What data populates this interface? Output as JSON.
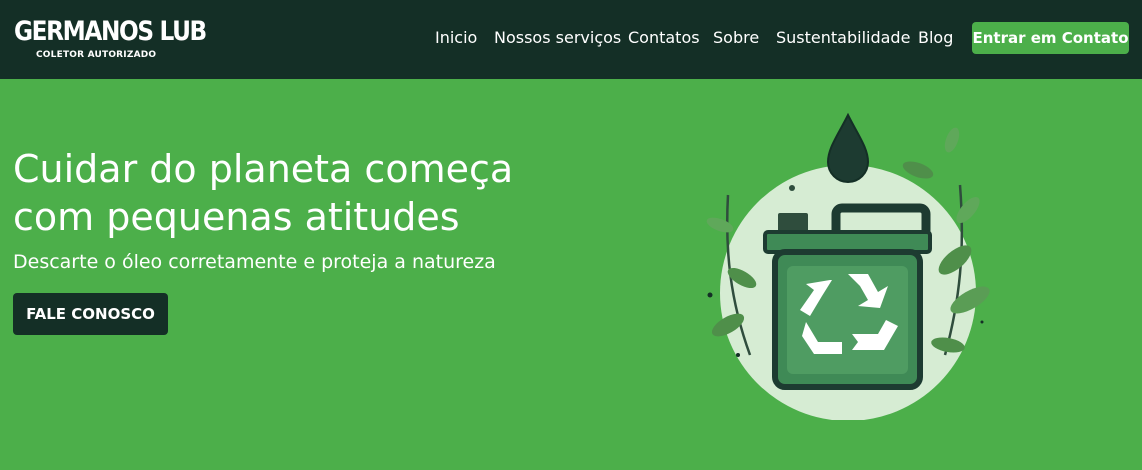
{
  "brand": {
    "name": "GERMANOS LUB",
    "tagline": "COLETOR AUTORIZADO"
  },
  "nav": {
    "items": [
      "Inicio",
      "Nossos serviços",
      "Contatos",
      "Sobre",
      "Sustentabilidade",
      "Blog"
    ],
    "cta_label": "Entrar em Contato"
  },
  "hero": {
    "title_line1": "Cuidar do planeta começa",
    "title_line2": "com pequenas atitudes",
    "subtitle": "Descarte o óleo corretamente e proteja a natureza",
    "button_label": "FALE CONOSCO",
    "illustration": "oil-canister-recycle-icon"
  },
  "colors": {
    "nav_bg": "#142f26",
    "page_bg": "#4caf4a",
    "accent": "#4caf4a",
    "dark": "#142f26",
    "text": "#ffffff"
  }
}
